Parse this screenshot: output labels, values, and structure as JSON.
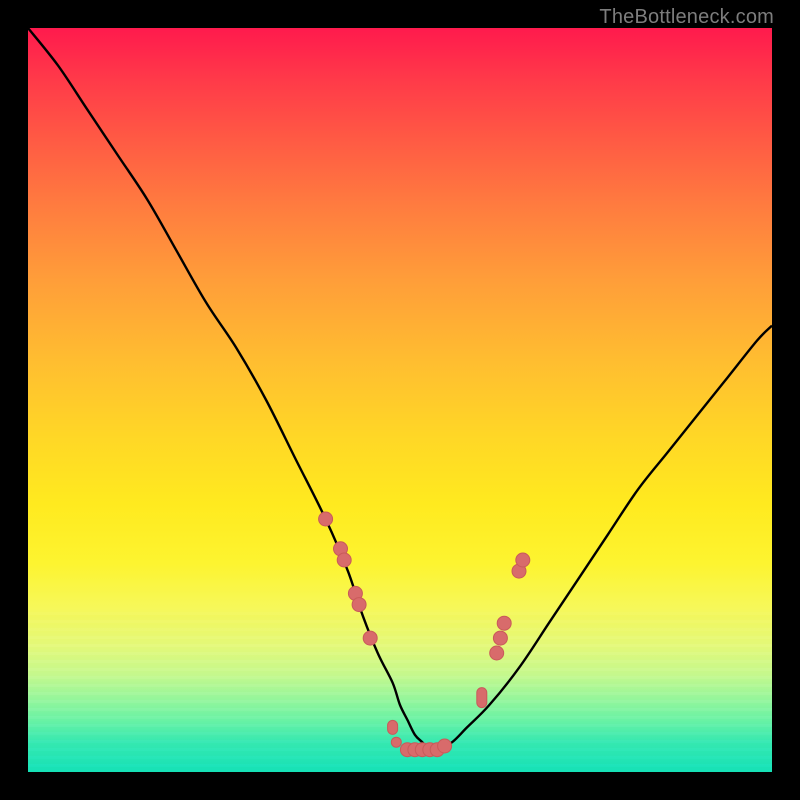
{
  "watermark": "TheBottleneck.com",
  "palette": {
    "frame_bg": "#000000",
    "curve_color": "#000000",
    "marker_fill": "#d86b6b",
    "marker_stroke": "#c95a5a"
  },
  "chart_data": {
    "type": "line",
    "title": "",
    "xlabel": "",
    "ylabel": "",
    "xlim": [
      0,
      100
    ],
    "ylim": [
      0,
      100
    ],
    "x": [
      0,
      4,
      8,
      12,
      16,
      20,
      24,
      28,
      32,
      36,
      40,
      43,
      45,
      47,
      49,
      50,
      51,
      52,
      53,
      54,
      55,
      57,
      59,
      62,
      66,
      70,
      74,
      78,
      82,
      86,
      90,
      94,
      98,
      100
    ],
    "values": [
      100,
      95,
      89,
      83,
      77,
      70,
      63,
      57,
      50,
      42,
      34,
      27,
      21,
      16,
      12,
      9,
      7,
      5,
      4,
      3,
      3,
      4,
      6,
      9,
      14,
      20,
      26,
      32,
      38,
      43,
      48,
      53,
      58,
      60
    ],
    "markers": [
      {
        "x": 40,
        "y": 34
      },
      {
        "x": 42,
        "y": 30
      },
      {
        "x": 42.5,
        "y": 28.5
      },
      {
        "x": 44,
        "y": 24
      },
      {
        "x": 44.5,
        "y": 22.5
      },
      {
        "x": 46,
        "y": 18
      },
      {
        "x": 49,
        "y": 6,
        "shape": "v7"
      },
      {
        "x": 49.5,
        "y": 4,
        "shape": "v5"
      },
      {
        "x": 51,
        "y": 3
      },
      {
        "x": 52,
        "y": 3
      },
      {
        "x": 53,
        "y": 3
      },
      {
        "x": 54,
        "y": 3
      },
      {
        "x": 55,
        "y": 3
      },
      {
        "x": 56,
        "y": 3.5
      },
      {
        "x": 61,
        "y": 10,
        "shape": "v10"
      },
      {
        "x": 63,
        "y": 16
      },
      {
        "x": 63.5,
        "y": 18
      },
      {
        "x": 64,
        "y": 20
      },
      {
        "x": 66,
        "y": 27
      },
      {
        "x": 66.5,
        "y": 28.5
      }
    ]
  }
}
